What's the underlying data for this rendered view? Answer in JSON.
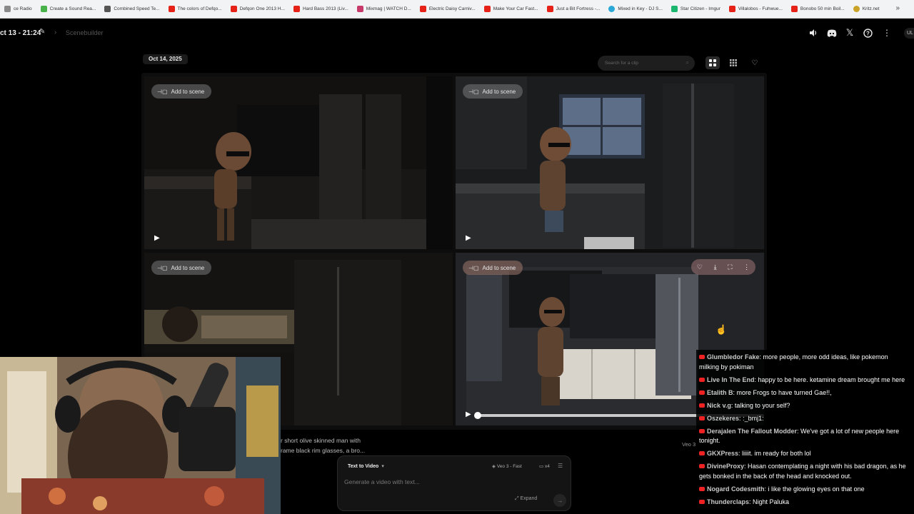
{
  "browser": {
    "bookmarks": [
      {
        "label": "ce Radio",
        "color": "#8a8a8a"
      },
      {
        "label": "Create a Sound Rea...",
        "color": "#47b14a"
      },
      {
        "label": "Combined Speed Te...",
        "color": "#555555"
      },
      {
        "label": "The colors of Defqo...",
        "color": "#e62117"
      },
      {
        "label": "Defqon One 2013 H...",
        "color": "#e62117"
      },
      {
        "label": "Hard Bass 2013 (Liv...",
        "color": "#e62117"
      },
      {
        "label": "Mixmag | WATCH D...",
        "color": "#c83a6a"
      },
      {
        "label": "Electric Daisy Carniv...",
        "color": "#e62117"
      },
      {
        "label": "Make Your Car Fast...",
        "color": "#e62117"
      },
      {
        "label": "Just a Bit Fortress -...",
        "color": "#e62117"
      },
      {
        "label": "Mixed in Key - DJ S...",
        "color": "#2aa8d8"
      },
      {
        "label": "Star Citizen - Imgur",
        "color": "#1bb76e"
      },
      {
        "label": "Villalobos - Fuhwue...",
        "color": "#e62117"
      },
      {
        "label": "Bonobo 50 min Boil...",
        "color": "#e62117"
      },
      {
        "label": "Kritz.net",
        "color": "#c9a227"
      }
    ],
    "more_label": "»"
  },
  "header": {
    "project_title": "ct 13 - 21:24",
    "breadcrumb_separator": "›",
    "breadcrumb_current": "Scenebuilder",
    "avatar_label": "UL",
    "icons": [
      "volume-icon",
      "discord-icon",
      "x-icon",
      "help-icon",
      "more-vertical-icon"
    ]
  },
  "toolbar": {
    "date": "Oct 14, 2025",
    "search_placeholder": "Search for a clip",
    "views": [
      "grid-large",
      "grid-small",
      "favorites"
    ]
  },
  "clips": [
    {
      "add_label": "Add to scene",
      "state": "idle"
    },
    {
      "add_label": "Add to scene",
      "state": "idle"
    },
    {
      "add_label": "Add to scene",
      "state": "idle"
    },
    {
      "add_label": "Add to scene",
      "state": "hover",
      "progress": 0
    }
  ],
  "prompt": {
    "preview_line1": "r short olive skinned man with",
    "preview_line2": "rame black rim glasses, a bro...",
    "model_tag": "Veo 3"
  },
  "composer": {
    "mode": "Text to Video",
    "model": "Veo 3 - Fast",
    "count": "x4",
    "placeholder": "Generate a video with text...",
    "expand_label": "Expand"
  },
  "chat": [
    {
      "user": "Glumbledor Fake",
      "text": "more people, more odd ideas, like pokemon milking by pokiman"
    },
    {
      "user": "Live In The End",
      "text": "happy to be here. ketamine dream brought me here"
    },
    {
      "user": "Etalith B",
      "text": "more Frogs to have turned Gae!!,"
    },
    {
      "user": "Nick v.g",
      "text": "talking to your self?"
    },
    {
      "user": "Oszekeres",
      "text": ":_bmj1:"
    },
    {
      "user": "Derajalen The Fallout Modder",
      "text": "We've got a lot of new people here tonight."
    },
    {
      "user": "GKXPress",
      "text": "liiiit. im ready for both lol"
    },
    {
      "user": "DivineProxy",
      "text": "Hasan contemplating a night with his bad dragon, as he gets bonked in the back of the head and knocked out."
    },
    {
      "user": "Nogard Codesmith",
      "text": "i like the glowing eyes on that one"
    },
    {
      "user": "Thunderclaps",
      "text": "Night Paluka"
    }
  ]
}
